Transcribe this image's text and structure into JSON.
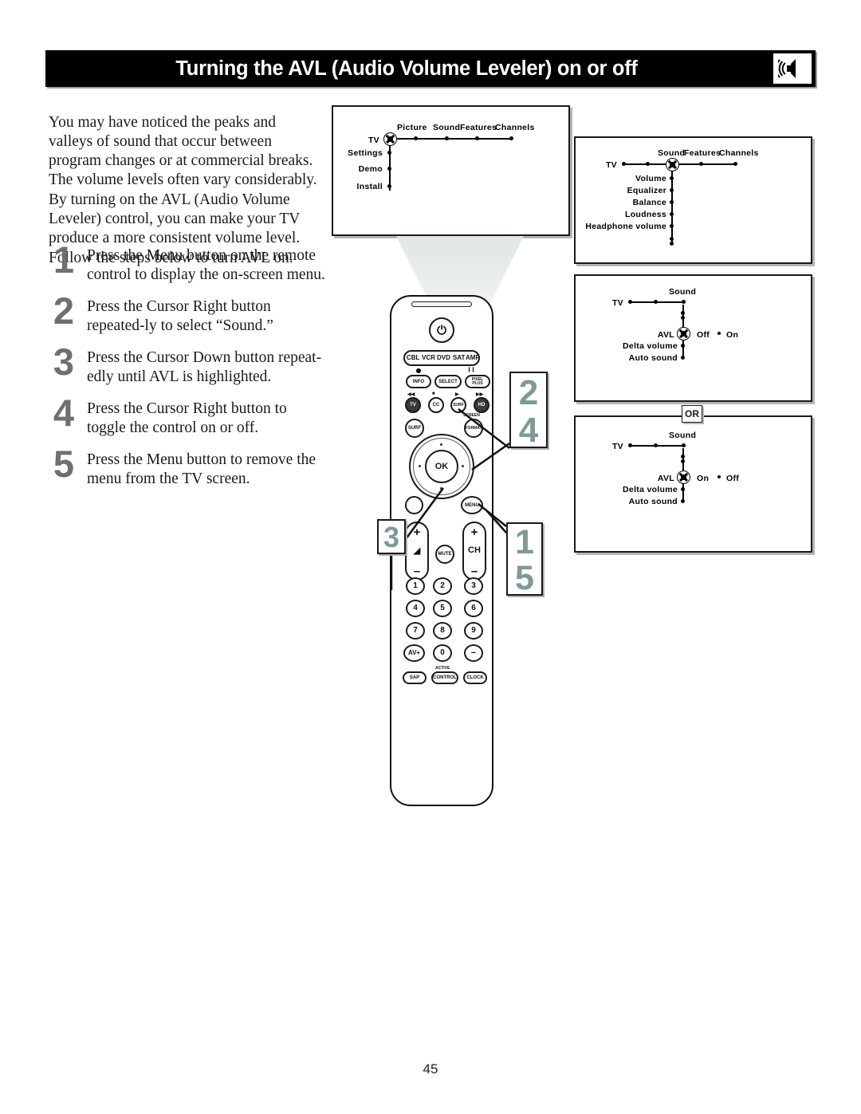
{
  "header": {
    "title": "Turning the AVL (Audio Volume Leveler) on or off",
    "icon": "speaker-sound-icon"
  },
  "intro": "You may have noticed the peaks and valleys of sound that occur between program changes or at commercial breaks. The volume levels often vary considerably. By turning on the AVL (Audio Volume Leveler) control, you can make your TV produce a more consistent volume level. Follow the steps below to turn AVL on.",
  "steps": [
    {
      "number": "1",
      "text": "Press the Menu button on the remote control to display the on-screen menu."
    },
    {
      "number": "2",
      "text": "Press the Cursor Right button repeated-ly to select “Sound.”"
    },
    {
      "number": "3",
      "text": "Press the Cursor Down button repeat-edly until AVL is highlighted."
    },
    {
      "number": "4",
      "text": "Press the Cursor Right button to toggle the control on or off."
    },
    {
      "number": "5",
      "text": "Press the Menu button to remove the menu from the TV screen."
    }
  ],
  "tv_screens": [
    {
      "id": "main-menu",
      "root": "TV",
      "horizontal_items": [
        "Picture",
        "Sound",
        "Features",
        "Channels"
      ],
      "vertical_items": [
        "Settings",
        "Demo",
        "Install"
      ]
    },
    {
      "id": "sound-menu",
      "root": "TV",
      "selected": "Sound",
      "horizontal_items": [
        "Sound",
        "Features",
        "Channels"
      ],
      "vertical_items": [
        "Volume",
        "Equalizer",
        "Balance",
        "Loudness",
        "Headphone volume"
      ]
    },
    {
      "id": "avl-off-on",
      "root": "TV",
      "branch": "Sound",
      "selected": "AVL",
      "options": [
        "Off",
        "On"
      ],
      "vertical_items": [
        "Delta volume",
        "Auto sound"
      ]
    },
    {
      "id": "avl-on-off",
      "root": "TV",
      "branch": "Sound",
      "selected": "AVL",
      "options": [
        "On",
        "Off"
      ],
      "vertical_items": [
        "Delta volume",
        "Auto sound"
      ]
    }
  ],
  "or_badge": "OR",
  "remote": {
    "power": "⏻",
    "mode_buttons": [
      "CBL",
      "VCR",
      "DVD",
      "SAT",
      "AMP"
    ],
    "function_row": [
      "INFO",
      "SELECT",
      "PIXEL PLUS"
    ],
    "transport_row": [
      "TV",
      "CC",
      "SURF",
      "HD"
    ],
    "lower_row": [
      "SURF",
      "FORMAT"
    ],
    "format_top_label": "SCREEN",
    "ok_label": "OK",
    "menu_label": "MENU",
    "mute_label": "MUTE",
    "volume_label": "◢",
    "channel_label": "CH",
    "plus": "+",
    "minus": "–",
    "keypad": [
      "1",
      "2",
      "3",
      "4",
      "5",
      "6",
      "7",
      "8",
      "9",
      "AV+",
      "0",
      "−"
    ],
    "bottom_row": [
      "SAP",
      "CONTROL",
      "CLOCK"
    ],
    "active_label": "ACTIVE"
  },
  "callouts": [
    {
      "id": "callout-24",
      "lines": [
        "2",
        "4"
      ]
    },
    {
      "id": "callout-15",
      "lines": [
        "1",
        "5"
      ]
    },
    {
      "id": "callout-3",
      "lines": [
        "3"
      ]
    }
  ],
  "page_number": "45",
  "colors": {
    "header_bg": "#000000",
    "header_text": "#ffffff",
    "step_number": "#6f6f6f",
    "callout_digit": "#7d9a98",
    "beam": "#e4ebe9"
  }
}
